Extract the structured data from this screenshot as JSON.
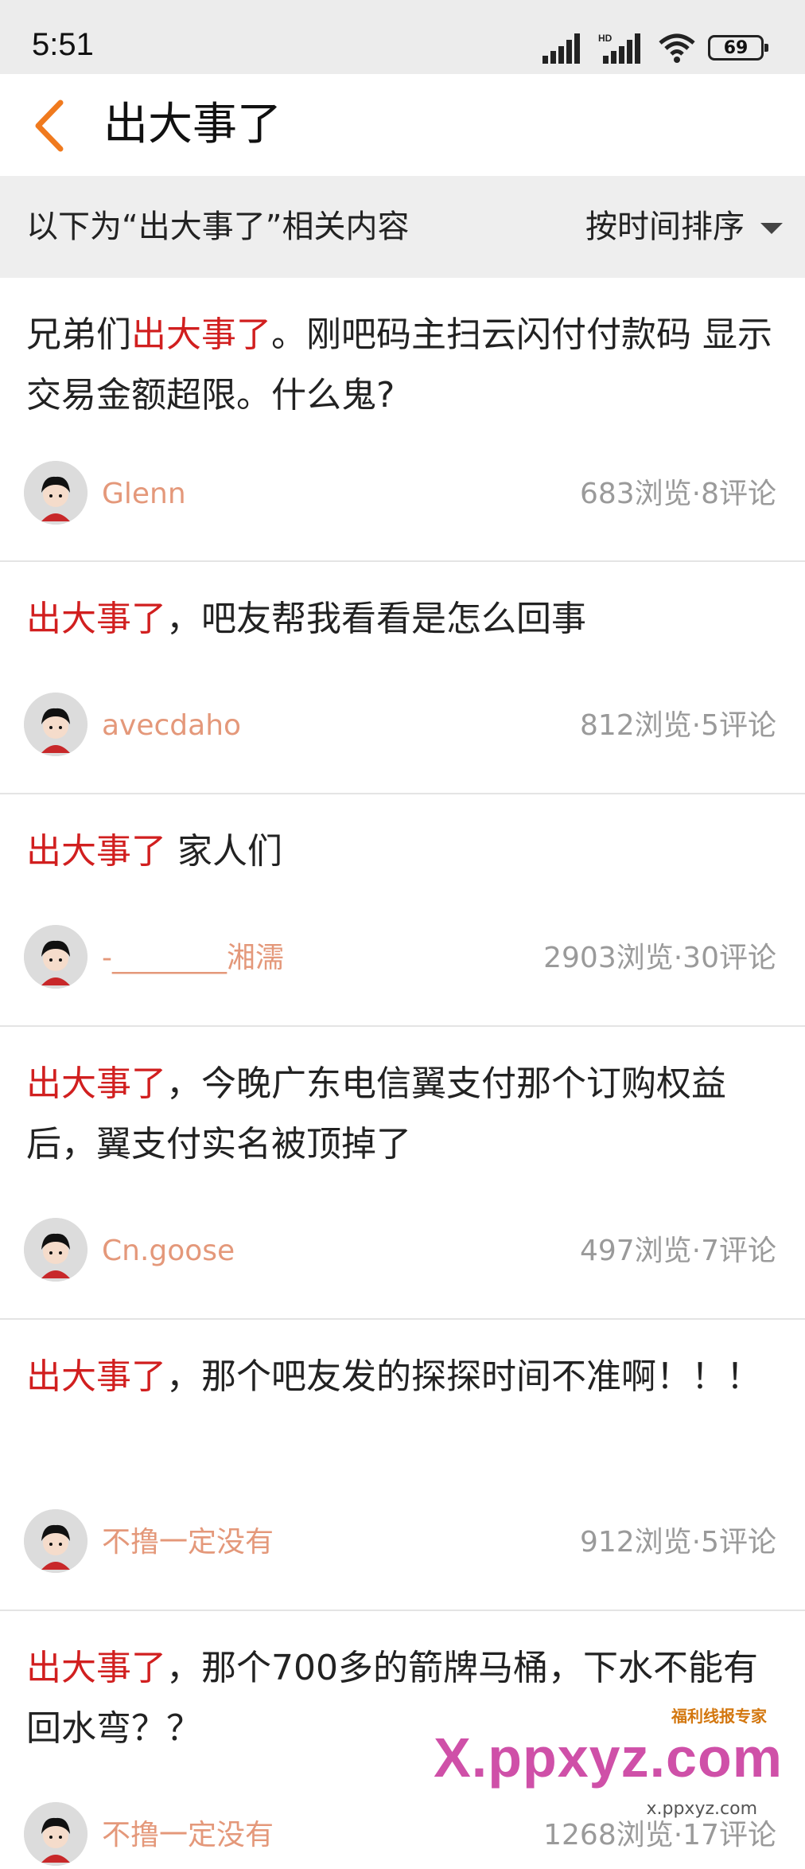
{
  "status_bar": {
    "time": "5:51",
    "battery": "69"
  },
  "nav": {
    "title": "出大事了"
  },
  "filter": {
    "label": "以下为“出大事了”相关内容",
    "sort_label": "按时间排序"
  },
  "posts": [
    {
      "title_highlight_prefix": "兄弟们",
      "title_highlight": "出大事了",
      "title_rest": "。刚吧码主扫云闪付付款码 显示交易金额超限。什么鬼?",
      "author": "Glenn",
      "stats": "683浏览·8评论"
    },
    {
      "title_highlight_prefix": "",
      "title_highlight": "出大事了",
      "title_rest": "，吧友帮我看看是怎么回事",
      "author": "avecdaho",
      "stats": "812浏览·5评论"
    },
    {
      "title_highlight_prefix": "",
      "title_highlight": "出大事了",
      "title_rest": " 家人们",
      "author": "-________湘濡",
      "stats": "2903浏览·30评论"
    },
    {
      "title_highlight_prefix": "",
      "title_highlight": "出大事了",
      "title_rest": "，今晚广东电信翼支付那个订购权益后，翼支付实名被顶掉了",
      "author": "Cn.goose",
      "stats": "497浏览·7评论"
    },
    {
      "title_highlight_prefix": "",
      "title_highlight": "出大事了",
      "title_rest": "，那个吧友发的探探时间不准啊！！！",
      "author": "不撸一定没有",
      "stats": "912浏览·5评论"
    },
    {
      "title_highlight_prefix": "",
      "title_highlight": "出大事了",
      "title_rest": "，那个700多的箭牌马桶，下水不能有回水弯？？",
      "author": "不撸一定没有",
      "stats": "1268浏览·17评论"
    }
  ],
  "watermark": {
    "brand": "X.ppxyz.com",
    "tag": "福利线报专家",
    "url": "x.ppxyz.com"
  },
  "colors": {
    "highlight": "#d11f1f",
    "author": "#e4987a",
    "back_arrow": "#f07a1e"
  }
}
